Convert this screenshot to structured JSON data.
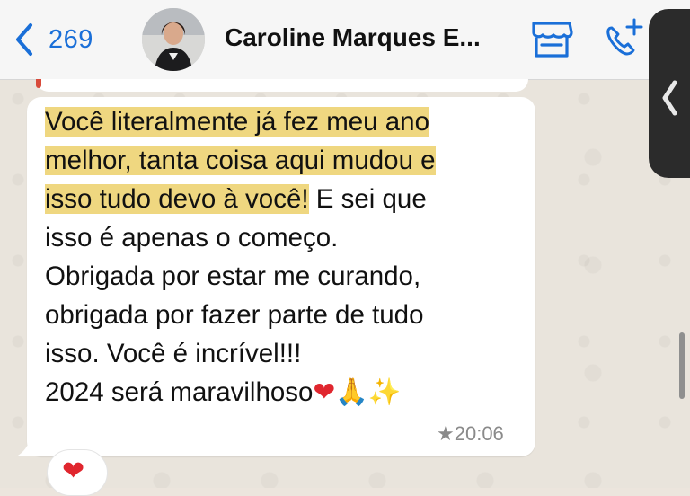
{
  "header": {
    "back_count": "269",
    "contact_name": "Caroline Marques E...",
    "icons": [
      "chevron-left-icon",
      "store-icon",
      "add-call-icon"
    ]
  },
  "message": {
    "highlight_lines": [
      "Você literalmente já fez meu ano",
      "melhor, tanta coisa aqui mudou e",
      "isso tudo devo à você!"
    ],
    "line3_rest": " E sei que",
    "plain_lines": [
      "isso é apenas o começo.",
      "Obrigada por estar me curando,",
      "obrigada por fazer parte de tudo",
      "isso. Você é incrível!!!"
    ],
    "last_line_text": "2024 será maravilhoso",
    "emojis": [
      "❤",
      "🙏",
      "✨"
    ],
    "star": "★",
    "time": "20:06",
    "reaction": "❤"
  },
  "colors": {
    "header_bg": "#f6f6f6",
    "accent_blue": "#1a6fd8",
    "highlight": "#efd780",
    "bubble": "#ffffff",
    "chat_bg": "#e9e4dc"
  }
}
